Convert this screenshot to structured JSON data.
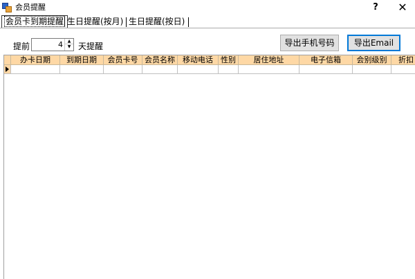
{
  "window": {
    "title": "会员提醒",
    "help_label": "?",
    "close_label": "✕"
  },
  "tabs": [
    {
      "label": "会员卡到期提醒",
      "active": true
    },
    {
      "label": "生日提醒(按月)",
      "active": false
    },
    {
      "label": "生日提醒(按日)",
      "active": false
    }
  ],
  "toolbar": {
    "prefix_label": "提前",
    "days_value": "4",
    "suffix_label": "天提醒",
    "export_phone_label": "导出手机号码",
    "export_email_label": "导出Email"
  },
  "grid": {
    "columns": [
      "办卡日期",
      "到期日期",
      "会员卡号",
      "会员名称",
      "移动电话",
      "性别",
      "居住地址",
      "电子信箱",
      "会别级别",
      "折扣"
    ],
    "header_color": "#fed8a5"
  }
}
